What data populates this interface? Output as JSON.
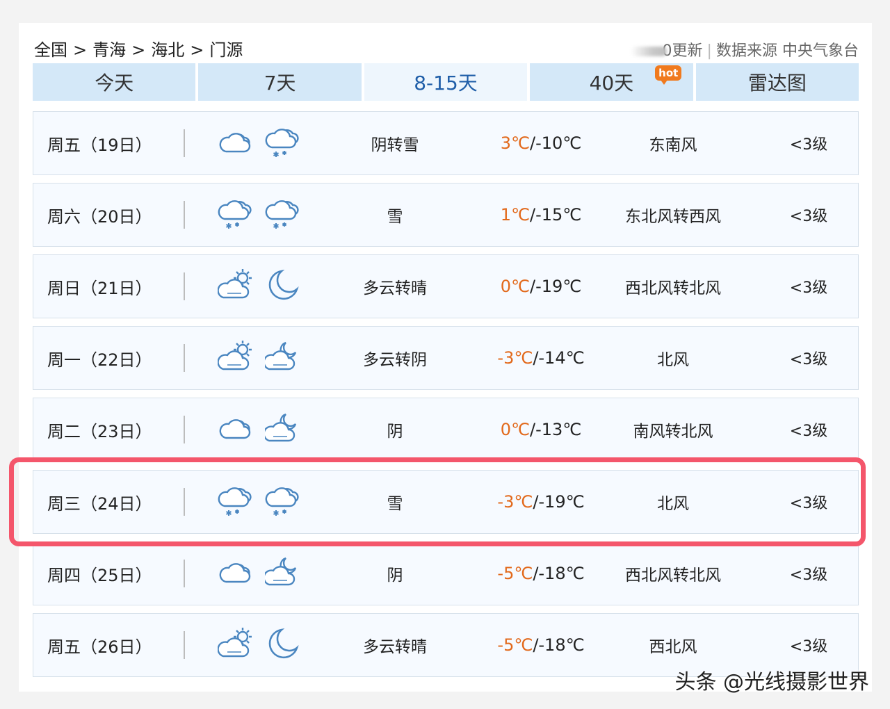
{
  "breadcrumb": {
    "items": [
      "全国",
      "青海",
      "海北",
      "门源"
    ],
    "separator": ">"
  },
  "meta": {
    "update_text": "0更新",
    "source_label": "数据来源",
    "source_name": "中央气象台"
  },
  "tabs": [
    {
      "label": "今天",
      "active": false
    },
    {
      "label": "7天",
      "active": false
    },
    {
      "label": "8-15天",
      "active": true
    },
    {
      "label": "40天",
      "active": false,
      "badge": "hot"
    },
    {
      "label": "雷达图",
      "active": false
    }
  ],
  "forecast": [
    {
      "day": "周五（19日）",
      "icon_day": "cloudy-icon",
      "icon_night": "snow-icon",
      "condition": "阴转雪",
      "high": "3℃",
      "low": "/-10℃",
      "wind": "东南风",
      "level": "<3级"
    },
    {
      "day": "周六（20日）",
      "icon_day": "snow-icon",
      "icon_night": "snow-icon",
      "condition": "雪",
      "high": "1℃",
      "low": "/-15℃",
      "wind": "东北风转西风",
      "level": "<3级"
    },
    {
      "day": "周日（21日）",
      "icon_day": "partly-cloudy-day-icon",
      "icon_night": "moon-icon",
      "condition": "多云转晴",
      "high": "0℃",
      "low": "/-19℃",
      "wind": "西北风转北风",
      "level": "<3级"
    },
    {
      "day": "周一（22日）",
      "icon_day": "partly-cloudy-day-icon",
      "icon_night": "partly-cloudy-night-icon",
      "condition": "多云转阴",
      "high": "-3℃",
      "low": "/-14℃",
      "wind": "北风",
      "level": "<3级"
    },
    {
      "day": "周二（23日）",
      "icon_day": "cloudy-icon",
      "icon_night": "partly-cloudy-night-icon",
      "condition": "阴",
      "high": "0℃",
      "low": "/-13℃",
      "wind": "南风转北风",
      "level": "<3级"
    },
    {
      "day": "周三（24日）",
      "icon_day": "snow-icon",
      "icon_night": "snow-icon",
      "condition": "雪",
      "high": "-3℃",
      "low": "/-19℃",
      "wind": "北风",
      "level": "<3级"
    },
    {
      "day": "周四（25日）",
      "icon_day": "cloudy-icon",
      "icon_night": "partly-cloudy-night-icon",
      "condition": "阴",
      "high": "-5℃",
      "low": "/-18℃",
      "wind": "西北风转北风",
      "level": "<3级"
    },
    {
      "day": "周五（26日）",
      "icon_day": "partly-cloudy-day-icon",
      "icon_night": "moon-icon",
      "condition": "多云转晴",
      "high": "-5℃",
      "low": "/-18℃",
      "wind": "西北风",
      "level": "<3级"
    }
  ],
  "highlighted_row": 5,
  "watermark": "头条 @光线摄影世界",
  "colors": {
    "tab_bg": "#d4e8f8",
    "tab_active_text": "#1f5ea8",
    "high_temp": "#e2691b",
    "highlight": "#f4566b",
    "icon_stroke": "#4a86c0"
  }
}
